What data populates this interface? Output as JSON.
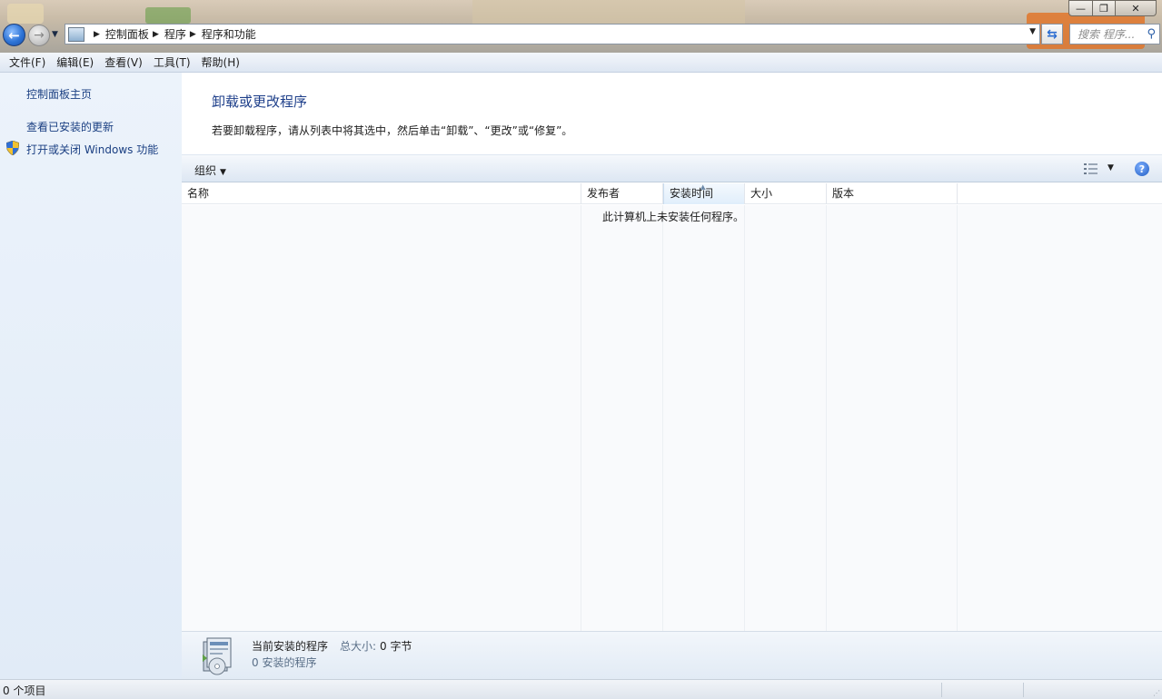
{
  "window": {
    "minimize_glyph": "—",
    "maximize_glyph": "❐",
    "close_glyph": "✕"
  },
  "address_bar": {
    "breadcrumbs": [
      "控制面板",
      "程序",
      "程序和功能"
    ],
    "search_placeholder": "搜索 程序..."
  },
  "menu": {
    "items": [
      "文件(F)",
      "编辑(E)",
      "查看(V)",
      "工具(T)",
      "帮助(H)"
    ]
  },
  "left_pane": {
    "links": [
      "控制面板主页",
      "查看已安装的更新",
      "打开或关闭 Windows 功能"
    ]
  },
  "main": {
    "heading": "卸载或更改程序",
    "instruction": "若要卸载程序，请从列表中将其选中，然后单击“卸载”、“更改”或“修复”。",
    "organize_label": "组织",
    "columns": [
      "名称",
      "发布者",
      "安装时间",
      "大小",
      "版本"
    ],
    "empty_message": "此计算机上未安装任何程序。"
  },
  "details": {
    "title": "当前安装的程序",
    "size_label": "总大小:",
    "size_value": "0 字节",
    "count": "0 安装的程序"
  },
  "status_bar": {
    "text": "0 个项目"
  },
  "colors": {
    "link": "#1a3f82",
    "heading": "#1e3f8a",
    "left_pane_bg": "#e6eef8"
  }
}
